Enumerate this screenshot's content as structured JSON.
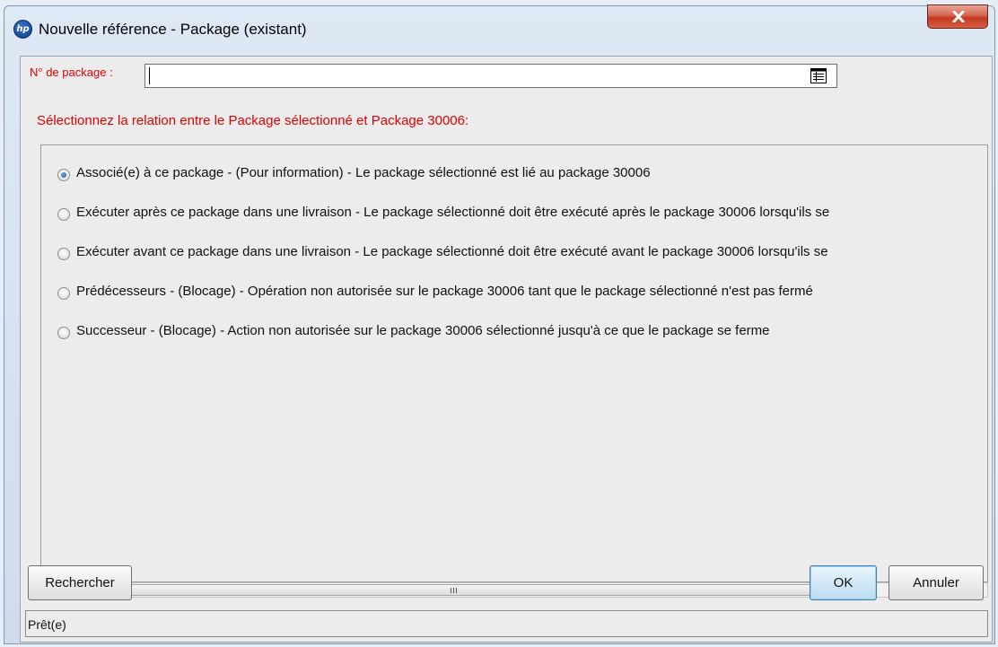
{
  "window": {
    "title": "Nouvelle référence - Package (existant)",
    "icon_text": "hp"
  },
  "package_field": {
    "label": "N° de package :",
    "value": "",
    "placeholder": ""
  },
  "instruction": "Sélectionnez la relation entre le Package sélectionné et Package 30006:",
  "relations": [
    {
      "label": "Associé(e) à ce package - (Pour information) - Le package sélectionné est lié au package 30006",
      "selected": true
    },
    {
      "label": "Exécuter après ce package dans une livraison - Le package sélectionné doit être exécuté après le package 30006 lorsqu'ils se",
      "selected": false
    },
    {
      "label": "Exécuter avant ce package dans une livraison - Le package sélectionné doit être exécuté avant le package 30006 lorsqu'ils se",
      "selected": false
    },
    {
      "label": "Prédécesseurs - (Blocage) - Opération non autorisée sur le package 30006 tant que le package sélectionné n'est pas fermé",
      "selected": false
    },
    {
      "label": "Successeur - (Blocage) - Action non autorisée sur le package 30006 sélectionné jusqu'à ce que le package se ferme",
      "selected": false
    }
  ],
  "buttons": {
    "search": "Rechercher",
    "ok": "OK",
    "cancel": "Annuler"
  },
  "status": "Prêt(e)",
  "colors": {
    "label_red": "#e00000",
    "close_red": "#c2391f"
  }
}
